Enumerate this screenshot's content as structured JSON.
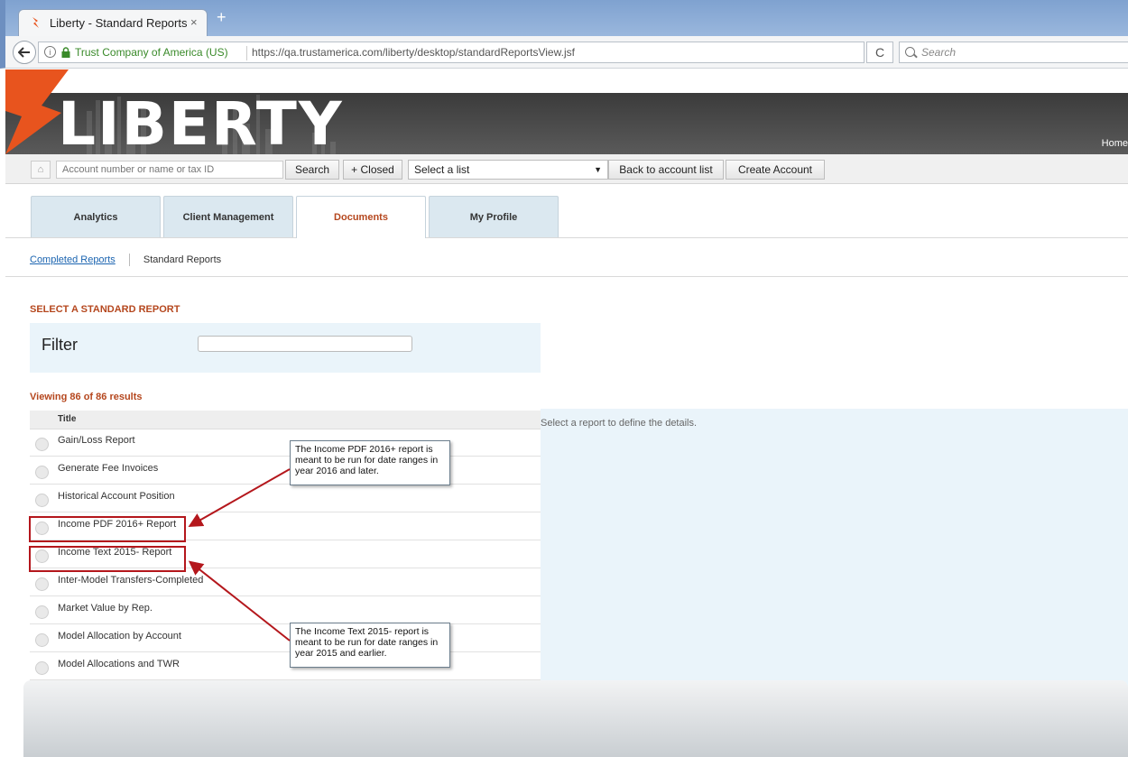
{
  "browser": {
    "tab_title": "Liberty - Standard Reports",
    "tab_close": "×",
    "new_tab": "+",
    "site_identity": "Trust Company of America (US)",
    "url": "https://qa.trustamerica.com/liberty/desktop/standardReportsView.jsf",
    "search_placeholder": "Search",
    "info": "i",
    "reload": "C"
  },
  "header": {
    "logo_text": "LIBERTY",
    "home_link": "Home",
    "brand_color": "#e8541e"
  },
  "toolbar": {
    "home_icon": "home-icon",
    "account_placeholder": "Account number or name or tax ID",
    "search_label": "Search",
    "closed_label": "+ Closed",
    "select_list_value": "Select a list",
    "back_label": "Back to account list",
    "create_label": "Create Account"
  },
  "tabs": [
    {
      "label": "Analytics",
      "active": false
    },
    {
      "label": "Client Management",
      "active": false
    },
    {
      "label": "Documents",
      "active": true
    },
    {
      "label": "My Profile",
      "active": false
    }
  ],
  "subnav": {
    "completed": "Completed Reports",
    "current": "Standard Reports"
  },
  "main": {
    "section_title": "SELECT A STANDARD REPORT",
    "filter_label": "Filter",
    "viewing": "Viewing 86 of 86 results",
    "column_title": "Title",
    "details_hint": "Select a report to define the details.",
    "reports": [
      "Gain/Loss Report",
      "Generate Fee Invoices",
      "Historical Account Position",
      "Income PDF 2016+ Report",
      "Income Text 2015- Report",
      "Inter-Model Transfers-Completed",
      "Market Value by Rep.",
      "Model Allocation by Account",
      "Model Allocations and TWR"
    ]
  },
  "annotations": {
    "callout_pdf": "The Income PDF 2016+ report is meant to be run for date ranges in year 2016 and later.",
    "callout_text": "The Income Text 2015- report is meant to be run for date ranges in year 2015 and earlier.",
    "highlight_color": "#b4171c"
  }
}
